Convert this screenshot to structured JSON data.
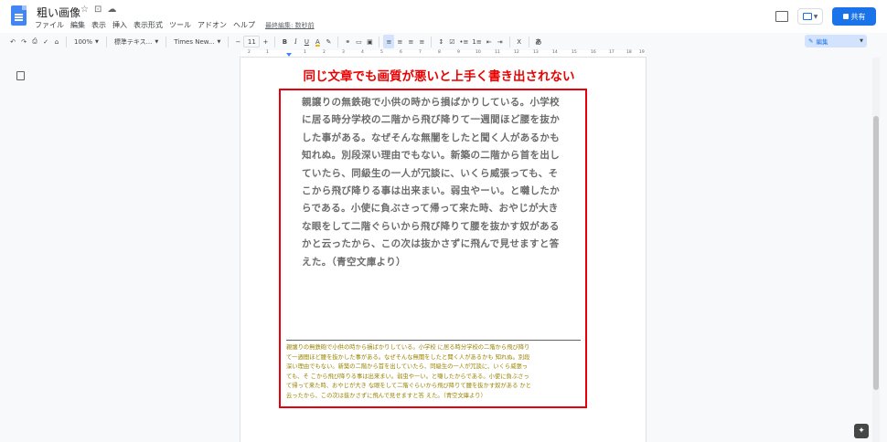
{
  "titlebar": {
    "doc_title": "粗い画像",
    "star_icon": "☆",
    "folder_icon": "⊡",
    "cloud_icon": "☁",
    "last_edit": "最終編集: 数秒前",
    "share_label": "共有"
  },
  "menu": [
    "ファイル",
    "編集",
    "表示",
    "挿入",
    "表示形式",
    "ツール",
    "アドオン",
    "ヘルプ"
  ],
  "toolbar": {
    "zoom": "100%",
    "style": "標準テキス...",
    "font": "Times New...",
    "font_size": "11",
    "bold": "B",
    "italic": "I",
    "underline": "U",
    "text_color": "A",
    "input_tools": "あ",
    "mode": "編集"
  },
  "ruler": {
    "numbers": [
      "2",
      "1",
      "1",
      "2",
      "3",
      "4",
      "5",
      "6",
      "7",
      "8",
      "9",
      "10",
      "11",
      "12",
      "13",
      "14",
      "15",
      "16",
      "17",
      "18",
      "19"
    ]
  },
  "document": {
    "headline": "同じ文章でも画質が悪いと上手く書き出されない",
    "image_lines": [
      "親譲りの無鉄砲で小供の時から損ばかりしている。小学校",
      "に居る時分学校の二階から飛び降りて一週間ほど腰を抜か",
      "した事がある。なぜそんな無闇をしたと聞く人があるかも",
      "知れぬ。別段深い理由でもない。新築の二階から首を出し",
      "ていたら、同級生の一人が冗談に、いくら威張っても、そ",
      "こから飛び降りる事は出来まい。弱虫やーい。と囃したか",
      "らである。小使に負ぶさって帰って来た時、おやじが大き",
      "な眼をして二階ぐらいから飛び降りて腰を抜かす奴がある",
      "かと云ったから、この次は抜かさずに飛んで見せますと答",
      "えた。（青空文庫より）"
    ],
    "ocr_lines": [
      "親譲りの無鉄砲で小供の時から損ばかりしている。小学校 に居る時分学校の二階から飛び降り",
      "て一週間ほど腰を抜かした事がある。なぜそんな無闇をしたと聞く人があるかも 知れぬ。別段",
      "深い理由でもない。新築の二階から首を出していたら、同級生の一人が冗談に、いくら威張っ",
      "ても、そ こから飛び降りる事は出来まい。弱虫やーい。と囃したからである。小使に負ぶさっ",
      "て帰って来た時、おやじが大き な眼をして二階ぐらいから飛び降りて腰を抜かす奴がある かと",
      "云ったから、この次は抜かさずに飛んで見せますと答 えた。（青空文庫より）"
    ]
  }
}
